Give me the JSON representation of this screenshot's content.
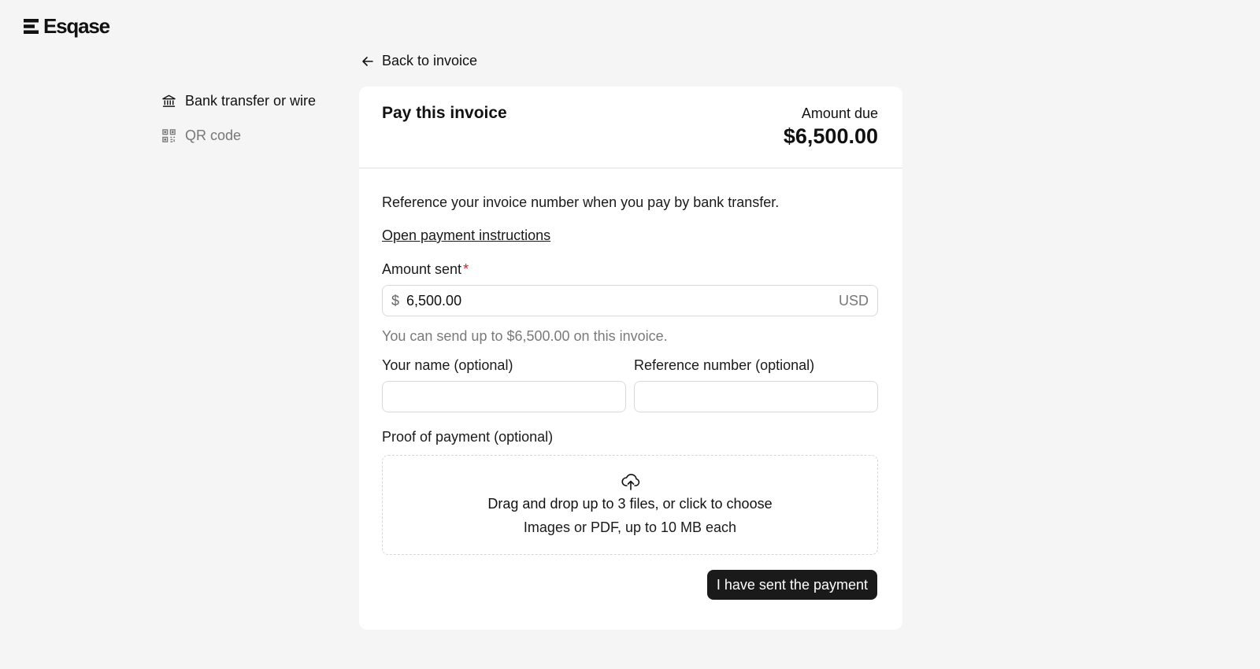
{
  "brand": {
    "name": "Esqase"
  },
  "nav": {
    "back_label": "Back to invoice",
    "methods": [
      {
        "label": "Bank transfer or wire",
        "icon": "bank-icon",
        "active": true
      },
      {
        "label": "QR code",
        "icon": "qr-code-icon",
        "active": false
      }
    ]
  },
  "card": {
    "title": "Pay this invoice",
    "amount_due_label": "Amount due",
    "amount_due": "$6,500.00",
    "intro": "Reference your invoice number when you pay by bank transfer.",
    "instructions_link": "Open payment instructions"
  },
  "form": {
    "amount_label": "Amount sent",
    "required_mark": "*",
    "currency_symbol": "$",
    "amount_value": "6,500.00",
    "currency_code": "USD",
    "amount_hint": "You can send up to $6,500.00 on this invoice.",
    "name_label": "Your name (optional)",
    "name_value": "",
    "reference_label": "Reference number (optional)",
    "reference_value": "",
    "proof_label": "Proof of payment (optional)",
    "dropzone_main": "Drag and drop up to 3 files, or click to choose",
    "dropzone_sub": "Images or PDF, up to 10 MB each",
    "submit_label": "I have sent the payment"
  },
  "colors": {
    "background": "#f5f5f5",
    "card": "#ffffff",
    "primary_button": "#1a1a1a",
    "required": "#d32020"
  }
}
